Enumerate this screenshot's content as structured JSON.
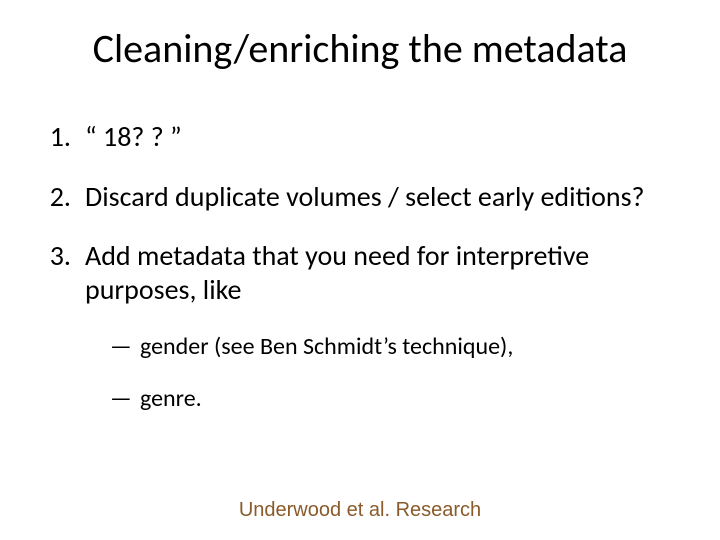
{
  "title": "Cleaning/enriching the metadata",
  "items": [
    {
      "num": "1.",
      "text": "“ 18? ? ”"
    },
    {
      "num": "2.",
      "text": "Discard duplicate volumes / select early editions?"
    },
    {
      "num": "3.",
      "text": "Add metadata that you need for interpretive purposes, like"
    }
  ],
  "subitems": [
    {
      "dash": "—",
      "text": "gender (see Ben Schmidt’s technique),"
    },
    {
      "dash": "—",
      "text": "genre."
    }
  ],
  "footer": "Underwood et al. Research"
}
